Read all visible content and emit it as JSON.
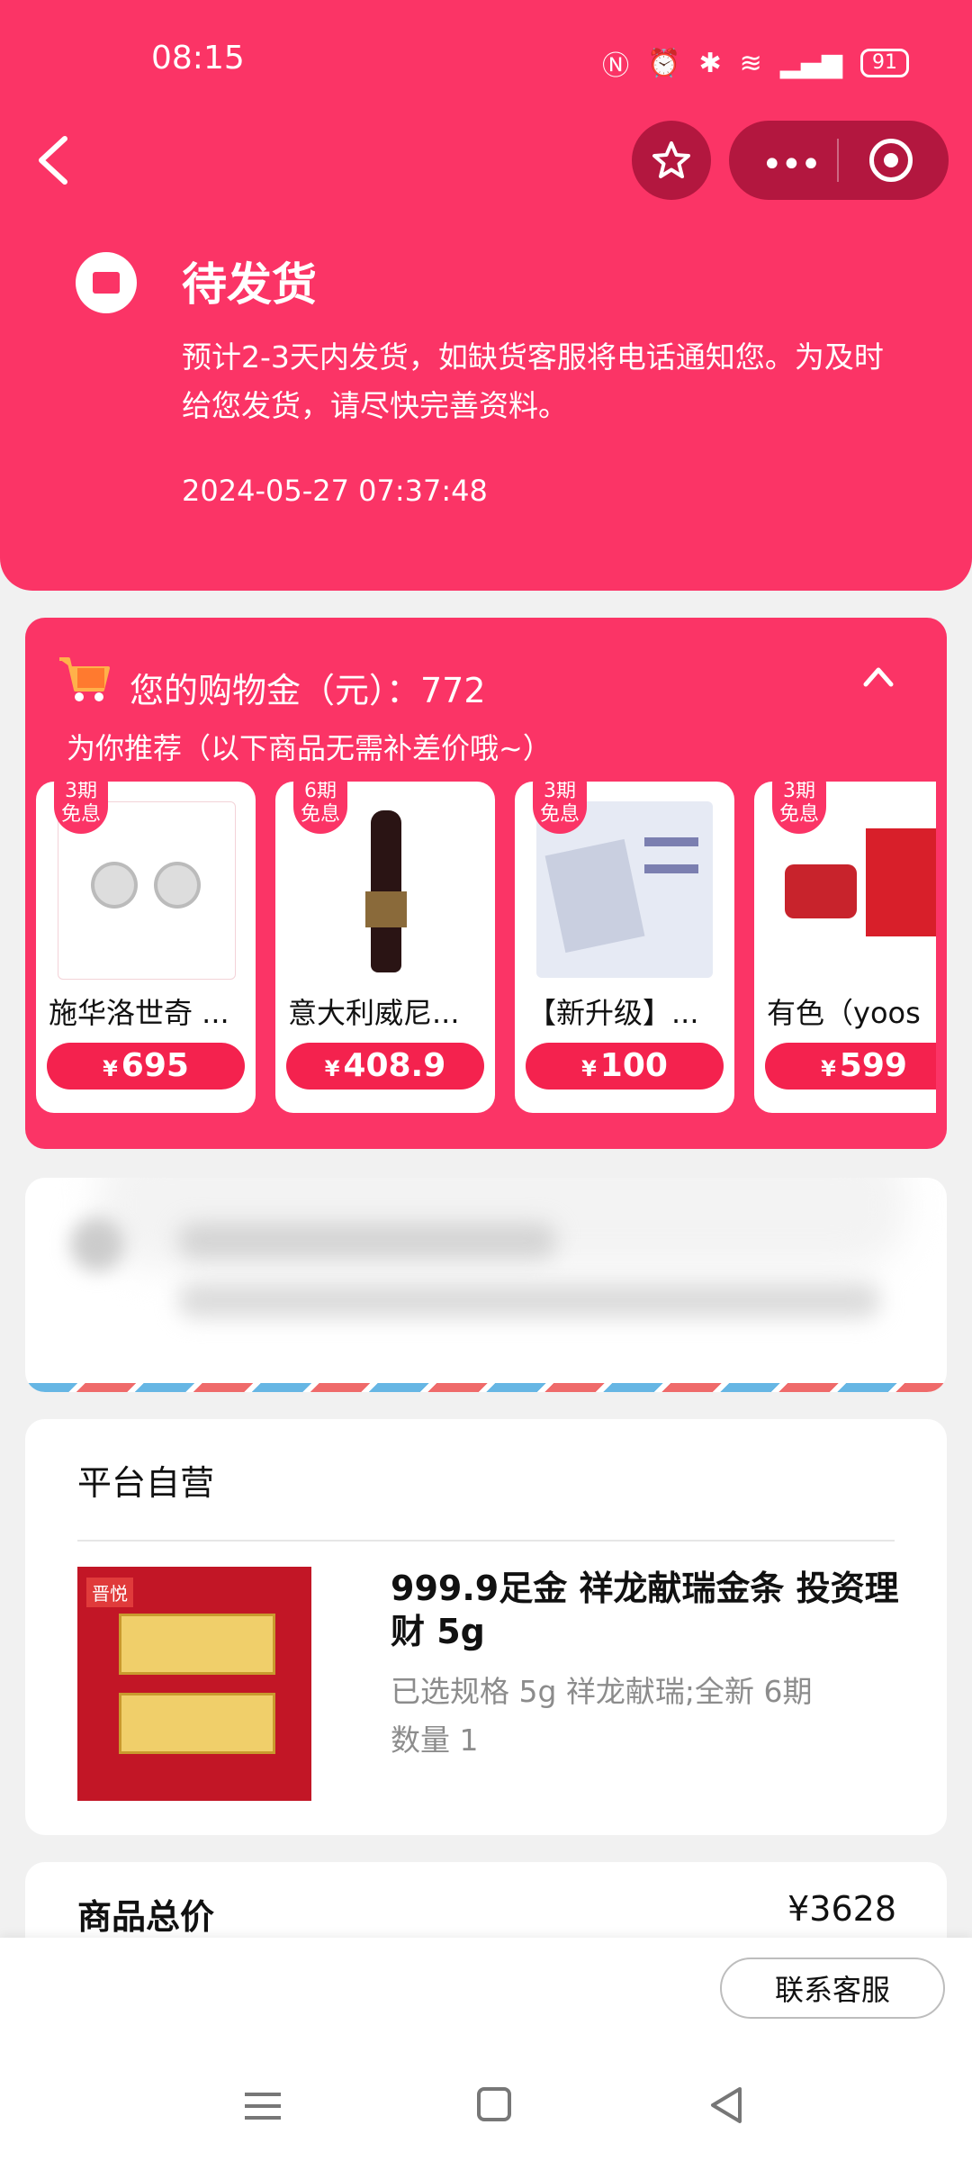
{
  "status_bar": {
    "time": "08:15",
    "battery": "91",
    "icons": [
      "nfc-icon",
      "alarm-icon",
      "bluetooth-icon",
      "wifi-icon",
      "hd-icon",
      "signal-icon",
      "4g-icon"
    ]
  },
  "nav": {
    "back": "back-icon",
    "star": "star-icon",
    "more": "more-icon",
    "target": "target-icon"
  },
  "order": {
    "status": "待发货",
    "description": "预计2-3天内发货，如缺货客服将电话通知您。为及时给您发货，请尽快完善资料。",
    "time": "2024-05-27 07:37:48"
  },
  "credit": {
    "title": "您的购物金（元）：772",
    "subtitle": "为你推荐（以下商品无需补差价哦~）",
    "products": [
      {
        "badge": "3期\n免息",
        "name": "施华洛世奇 ...",
        "currency": "¥",
        "price": "695"
      },
      {
        "badge": "6期\n免息",
        "name": "意大利威尼...",
        "currency": "¥",
        "price": "408.9"
      },
      {
        "badge": "3期\n免息",
        "name": "【新升级】...",
        "currency": "¥",
        "price": "100"
      },
      {
        "badge": "3期\n免息",
        "name": "有色（yoos",
        "currency": "¥",
        "price": "599"
      }
    ]
  },
  "store": {
    "name": "平台自营",
    "item_title": "999.9足金 祥龙献瑞金条 投资理财 5g",
    "spec": "已选规格 5g 祥龙献瑞;全新 6期",
    "qty": "数量 1",
    "image_tag": "晋悦"
  },
  "total": {
    "label": "商品总价",
    "value": "¥3628"
  },
  "bottom": {
    "contact": "联系客服"
  },
  "colors": {
    "brand": "#fb3466",
    "price_btn": "#f4224e"
  }
}
